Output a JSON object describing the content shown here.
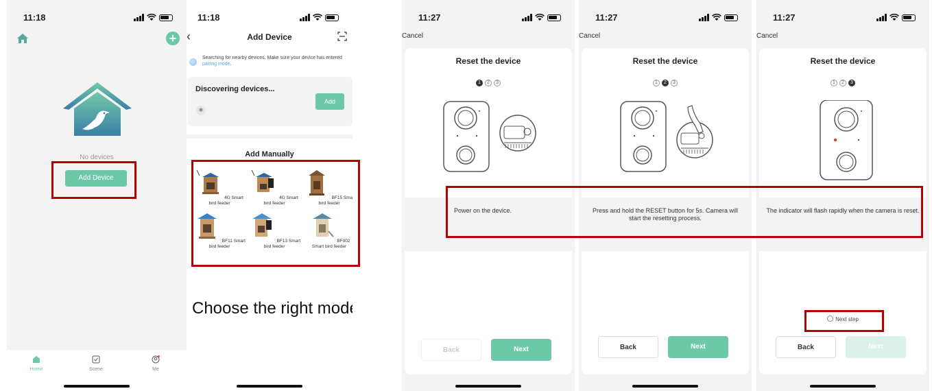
{
  "colors": {
    "accent": "#6cc8a7",
    "highlight": "#b30000",
    "link": "#5aa7e8"
  },
  "phone1": {
    "time": "11:18",
    "icons": [
      "home-icon",
      "plus-circle-icon",
      "bird-house-logo"
    ],
    "no_devices": "No devices",
    "add_device_label": "Add Device",
    "tabs": [
      {
        "label": "Home",
        "icon": "home-icon"
      },
      {
        "label": "Scene",
        "icon": "scene-check-icon"
      },
      {
        "label": "Me",
        "icon": "profile-icon"
      }
    ]
  },
  "phone2": {
    "time": "11:18",
    "title": "Add Device",
    "searching_text": "Searching for nearby devices. Make sure your device has entered ",
    "pairing_link": "pairing mode",
    "searching_suffix": ".",
    "discovering": "Discovering devices...",
    "add_label": "Add",
    "manual_title": "Add Manually",
    "models": [
      {
        "label": "4G Smart bird feeder"
      },
      {
        "label": "4G Smart bird feeder"
      },
      {
        "label": "BF15 Smart bird feeder"
      },
      {
        "label": "BF11 Smart bird feeder"
      },
      {
        "label": "BF13 Smart bird feeder"
      },
      {
        "label": "BF002 Smart bird feeder"
      }
    ],
    "caption": "Choose the right model"
  },
  "reset_screens": [
    {
      "time": "11:27",
      "cancel": "Cancel",
      "title": "Reset the device",
      "step_labels": [
        "1",
        "2",
        "3"
      ],
      "instruction": "Power on the device.",
      "back_label": "Back",
      "next_label": "Next"
    },
    {
      "time": "11:27",
      "cancel": "Cancel",
      "title": "Reset the device",
      "step_labels": [
        "1",
        "2",
        "3"
      ],
      "instruction": "Press and hold the RESET button for 5s. Camera will start the resetting process.",
      "back_label": "Back",
      "next_label": "Next"
    },
    {
      "time": "11:27",
      "cancel": "Cancel",
      "title": "Reset the device",
      "step_labels": [
        "1",
        "2",
        "3"
      ],
      "instruction": "The indicator will flash rapidly when the camera is reset.",
      "next_step": "Next step",
      "back_label": "Back",
      "next_label": "Next"
    }
  ]
}
